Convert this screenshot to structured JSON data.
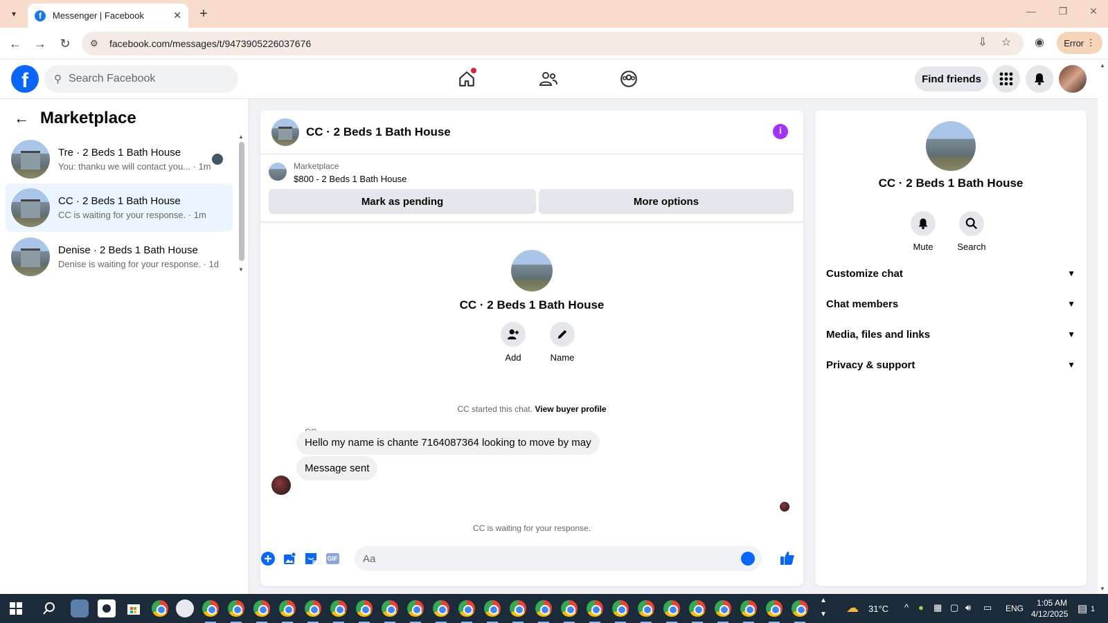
{
  "browser": {
    "tab_title": "Messenger | Facebook",
    "url": "facebook.com/messages/t/9473905226037676",
    "profile_status": "Error"
  },
  "header": {
    "search_placeholder": "Search Facebook",
    "find_friends": "Find friends"
  },
  "sidebar": {
    "title": "Marketplace",
    "conversations": [
      {
        "name": "Tre · 2 Beds 1 Bath House",
        "preview": "You: thanku we will contact you... · 1m"
      },
      {
        "name": "CC · 2 Beds 1 Bath House",
        "preview": "CC is waiting for your response. · 1m"
      },
      {
        "name": "Denise · 2 Beds 1 Bath House",
        "preview": "Denise is waiting for your response. · 1d"
      }
    ]
  },
  "chat": {
    "title": "CC · 2 Beds 1 Bath House",
    "marketplace_label": "Marketplace",
    "listing": "$800 - 2 Beds 1 Bath House",
    "mark_pending": "Mark as pending",
    "more_options": "More options",
    "intro_name": "CC · 2 Beds 1 Bath House",
    "add_label": "Add",
    "name_label": "Name",
    "started_text": "CC started this chat.",
    "view_buyer": "View buyer profile",
    "sender": "CC",
    "message_1": "Hello my name is chante 7164087364 looking to move by may",
    "message_2": "Message sent",
    "waiting": "CC is waiting for your response.",
    "input_placeholder": "Aa",
    "gif_label": "GIF"
  },
  "details": {
    "name": "CC · 2 Beds 1 Bath House",
    "mute": "Mute",
    "search": "Search",
    "sections": [
      "Customize chat",
      "Chat members",
      "Media, files and links",
      "Privacy & support"
    ]
  },
  "taskbar": {
    "weather": "31°C",
    "language": "ENG",
    "time": "1:05 AM",
    "date": "4/12/2025",
    "notifications": "1"
  },
  "colors": {
    "brand": "#0866ff",
    "tabbar": "#f7dccb",
    "info": "#a033ff"
  }
}
